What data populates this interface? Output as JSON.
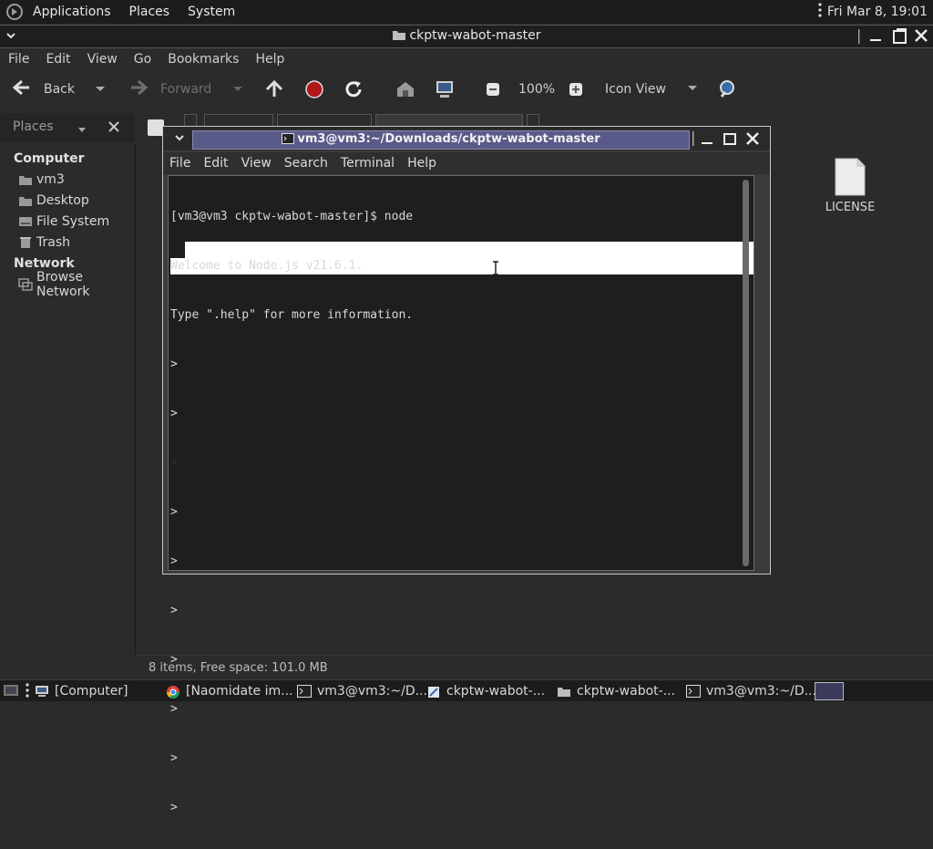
{
  "top_panel": {
    "menus": [
      "Applications",
      "Places",
      "System"
    ],
    "clock": "Fri Mar  8, 19:01"
  },
  "file_manager": {
    "title": "ckptw-wabot-master",
    "menus": [
      "File",
      "Edit",
      "View",
      "Go",
      "Bookmarks",
      "Help"
    ],
    "toolbar": {
      "back": "Back",
      "forward": "Forward",
      "zoom": "100%",
      "view_mode": "Icon View"
    },
    "places_label": "Places",
    "sidebar": {
      "computer_heading": "Computer",
      "computer_items": [
        "vm3",
        "Desktop",
        "File System",
        "Trash"
      ],
      "network_heading": "Network",
      "network_items": [
        "Browse Network"
      ]
    },
    "files": [
      {
        "name": "LICENSE"
      }
    ],
    "status": "8 items, Free space: 101.0 MB"
  },
  "terminal": {
    "title": "vm3@vm3:~/Downloads/ckptw-wabot-master",
    "menus": [
      "File",
      "Edit",
      "View",
      "Search",
      "Terminal",
      "Help"
    ],
    "lines": [
      "[vm3@vm3 ckptw-wabot-master]$ node",
      "Welcome to Node.js v21.6.1.",
      "Type \".help\" for more information.",
      ">",
      ">",
      ">",
      ">",
      ">",
      ">",
      ">",
      ">",
      ">",
      ">"
    ]
  },
  "taskbar": {
    "items": [
      "[Computer]",
      "[Naomidate im...",
      "vm3@vm3:~/D...",
      "ckptw-wabot-...",
      "ckptw-wabot-...",
      "vm3@vm3:~/D..."
    ]
  },
  "colors": {
    "terminal_title_bg": "#5a5a8a",
    "selection": "#ffffff",
    "panel": "#1c1c1c"
  }
}
